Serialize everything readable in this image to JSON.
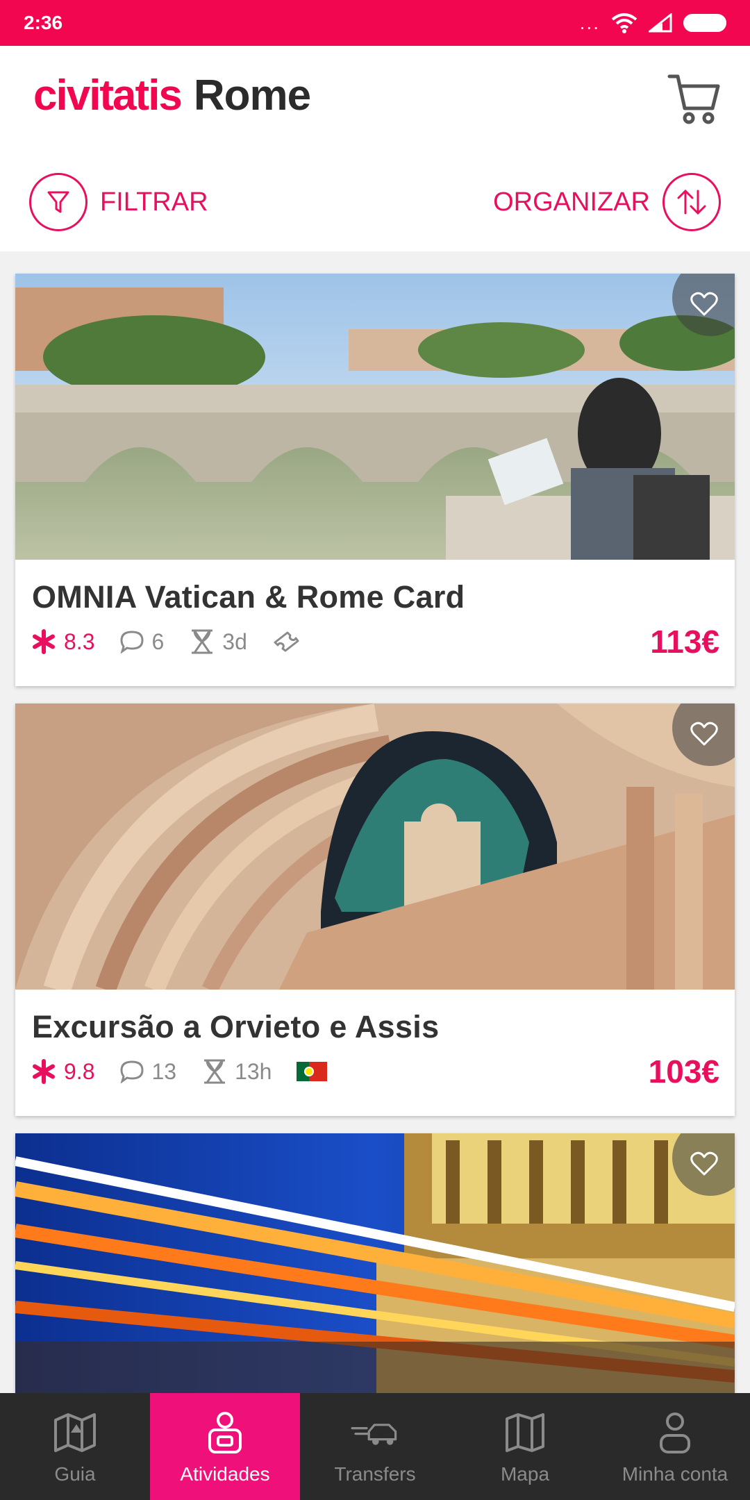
{
  "status_bar": {
    "time": "2:36",
    "dots": "..."
  },
  "header": {
    "brand": "civitatis",
    "city": "Rome"
  },
  "toolbar": {
    "filter_label": "FILTRAR",
    "sort_label": "ORGANIZAR"
  },
  "colors": {
    "brand": "#f2064f",
    "accent": "#e8105e",
    "nav_active": "#f0107a",
    "nav_bg": "#2a2a2a"
  },
  "activities": [
    {
      "title": "OMNIA Vatican & Rome Card",
      "rating": "8.3",
      "comments": "6",
      "duration": "3d",
      "extra_icon": "ticket-icon",
      "price": "113€"
    },
    {
      "title": "Excursão a Orvieto e Assis",
      "rating": "9.8",
      "comments": "13",
      "duration": "13h",
      "extra_icon": "portugal-flag-icon",
      "price": "103€"
    },
    {
      "title": "",
      "rating": "",
      "comments": "",
      "duration": "",
      "price": ""
    }
  ],
  "nav": [
    {
      "label": "Guia",
      "icon": "map-guide-icon"
    },
    {
      "label": "Atividades",
      "icon": "activities-icon",
      "active": true
    },
    {
      "label": "Transfers",
      "icon": "car-icon"
    },
    {
      "label": "Mapa",
      "icon": "map-icon"
    },
    {
      "label": "Minha conta",
      "icon": "user-icon"
    }
  ]
}
